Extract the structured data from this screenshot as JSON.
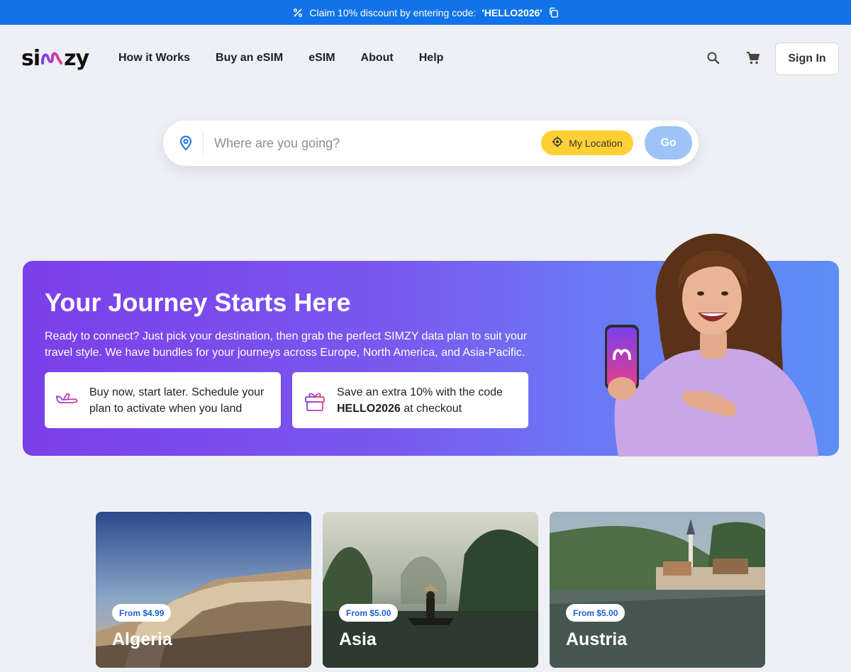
{
  "promo": {
    "text": "Claim 10% discount by entering code:",
    "code": "'HELLO2026'",
    "icon": "percent-icon",
    "copy_icon": "copy-icon"
  },
  "header": {
    "logo": "simzy",
    "nav": [
      "How it Works",
      "Buy an eSIM",
      "eSIM",
      "About",
      "Help"
    ],
    "search_icon": "search-icon",
    "cart_icon": "cart-icon",
    "signin_label": "Sign In"
  },
  "search": {
    "placeholder": "Where are you going?",
    "my_location_label": "My Location",
    "go_label": "Go"
  },
  "hero": {
    "title": "Your Journey Starts Here",
    "description": "Ready to connect? Just pick your destination, then grab the perfect SIMZY data plan to suit your travel style. We have bundles for your journeys across Europe, North America, and Asia-Pacific.",
    "feature1": "Buy now, start later. Schedule your plan to activate when you land",
    "feature2_prefix": "Save an extra 10% with the code",
    "feature2_code": "HELLO2026",
    "feature2_suffix": "at checkout"
  },
  "destinations": [
    {
      "name": "Algeria",
      "price": "From $4.99"
    },
    {
      "name": "Asia",
      "price": "From $5.00"
    },
    {
      "name": "Austria",
      "price": "From $5.00"
    }
  ],
  "colors": {
    "promo_bar": "#1273e8",
    "accent_yellow": "#ffd036",
    "go_button": "#9ec4f7",
    "hero_start": "#7b3fe9",
    "hero_end": "#5d8ef6",
    "price_text": "#1a5fd0"
  }
}
